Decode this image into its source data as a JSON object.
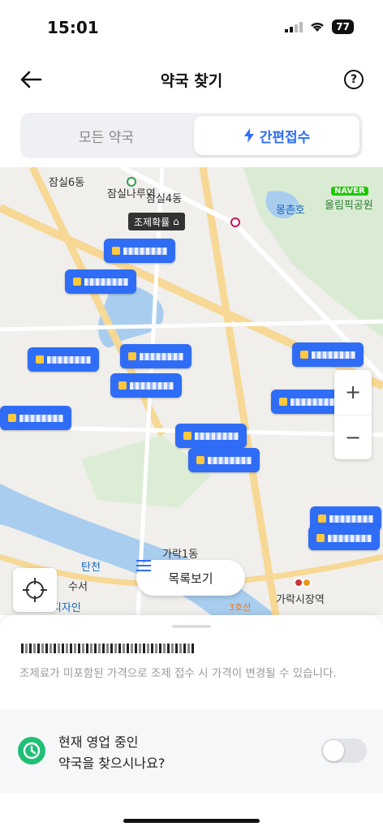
{
  "status": {
    "time": "15:01",
    "battery": "77"
  },
  "header": {
    "title": "약국 찾기",
    "back_icon": "arrow-left-icon",
    "help_icon": "question-circle-icon",
    "help_glyph": "?"
  },
  "tabs": [
    {
      "label": "모든 약국",
      "selected": false
    },
    {
      "label": "간편접수",
      "selected": true,
      "icon": "lightning-icon"
    }
  ],
  "map": {
    "labels": {
      "jamsil6": "잠실6동",
      "jamsilnaru": "잠실나루역",
      "jamsil4": "잠실4동",
      "naver": "NAVER",
      "olympic": "올림픽공원",
      "mongchon": "몽촌호",
      "garak1": "가락1동",
      "garaksijang": "가락시장역",
      "tancheon": "탄천",
      "suseo": "수서",
      "daejin": "대진디자인",
      "line3": "3호선"
    },
    "fee_tag": "조제확률",
    "zoom_in": "+",
    "zoom_out": "−",
    "list_button": "목록보기",
    "list_icon": "list-icon",
    "locate_icon": "crosshair-icon",
    "pharmacy_pin_count": 12
  },
  "sheet": {
    "notice": "조제료가 미포함된 가격으로 조제 접수 시 가격이 변경될 수 있습니다.",
    "open_question_line1": "현재 영업 중인",
    "open_question_line2": "약국을 찾으시나요?",
    "open_toggle_on": false,
    "clock_icon": "clock-icon"
  },
  "colors": {
    "accent": "#2f6df6",
    "green": "#1fbf76"
  }
}
